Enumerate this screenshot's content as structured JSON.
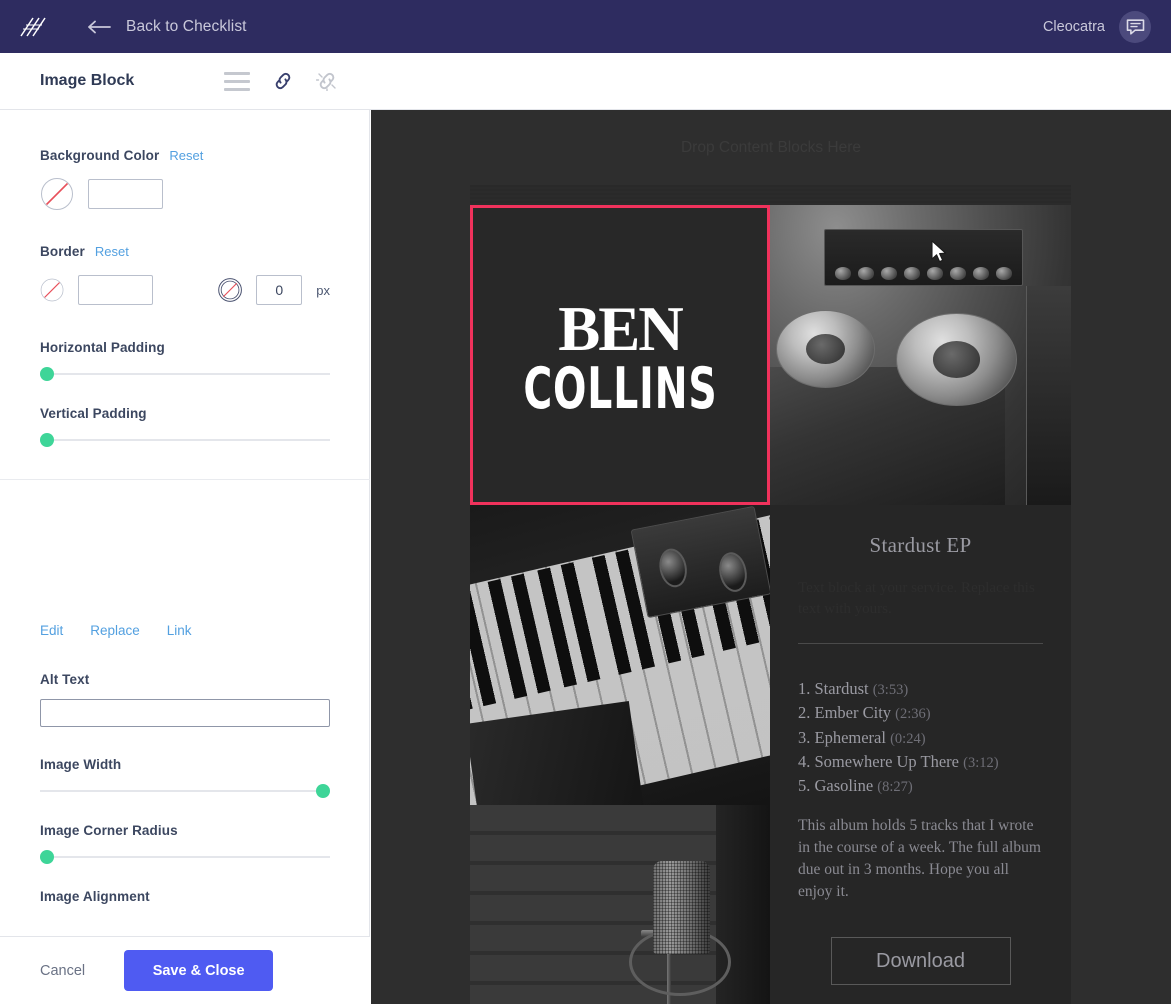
{
  "topnav": {
    "logo_icon": "slashes-logo-icon",
    "back_arrow_icon": "arrow-left-icon",
    "back_label": "Back to Checklist",
    "user_name": "Cleocatra",
    "avatar_icon": "chat-bubble-icon"
  },
  "subheader": {
    "block_title": "Image Block",
    "icons": [
      {
        "name": "hamburger-menu-icon",
        "state": "inactive"
      },
      {
        "name": "link-icon",
        "state": "active"
      },
      {
        "name": "unlink-icon",
        "state": "inactive"
      }
    ]
  },
  "panel": {
    "background_color": {
      "label": "Background Color",
      "reset_label": "Reset",
      "swatch_icon": "no-color-swatch-icon",
      "hex_value": "",
      "hex_placeholder": ""
    },
    "border": {
      "label": "Border",
      "reset_label": "Reset",
      "swatch_icon": "no-color-swatch-icon",
      "hex_value": "",
      "style_icon": "no-border-style-icon",
      "width_value": "0",
      "unit_label": "px"
    },
    "horizontal_padding": {
      "label": "Horizontal Padding",
      "percent": 2
    },
    "vertical_padding": {
      "label": "Vertical Padding",
      "percent": 2
    },
    "image_actions": {
      "edit_label": "Edit",
      "replace_label": "Replace",
      "link_label": "Link"
    },
    "alt_text": {
      "label": "Alt Text",
      "value": "",
      "placeholder": ""
    },
    "image_width": {
      "label": "Image Width",
      "percent": 100
    },
    "image_corner_radius": {
      "label": "Image Corner Radius",
      "percent": 2
    },
    "image_alignment": {
      "label": "Image Alignment"
    },
    "footer": {
      "cancel_label": "Cancel",
      "save_label": "Save & Close"
    }
  },
  "canvas": {
    "drop_hint": "Drop Content Blocks Here",
    "album_art": {
      "line1": "BEN",
      "line2": "COLLINS",
      "selected": true
    },
    "photos": [
      {
        "name": "reel-to-reel-tape-machine-photo"
      },
      {
        "name": "piano-keyboard-photo"
      },
      {
        "name": "studio-microphone-photo"
      }
    ],
    "tracklist_block": {
      "ep_title": "Stardust EP",
      "placeholder_text": "Text block at your service. Replace this text with yours.",
      "tracks": [
        {
          "num": "1.",
          "title": "Stardust",
          "duration": "(3:53)"
        },
        {
          "num": "2.",
          "title": "Ember City",
          "duration": "(2:36)"
        },
        {
          "num": "3.",
          "title": "Ephemeral",
          "duration": "(0:24)"
        },
        {
          "num": "4.",
          "title": "Somewhere Up There",
          "duration": "(3:12)"
        },
        {
          "num": "5.",
          "title": "Gasoline",
          "duration": "(8:27)"
        }
      ],
      "description": "This album holds 5 tracks that I wrote in the course of a week. The full album due out in 3 months. Hope you all enjoy it.",
      "download_label": "Download"
    }
  },
  "colors": {
    "nav_background": "#2e2c60",
    "accent_blue": "#53a0e0",
    "save_button": "#4f5bf2",
    "slider_handle": "#3ed598",
    "selection_border": "#f0325c",
    "canvas_background": "#2e2e2e",
    "email_background": "#262626"
  }
}
